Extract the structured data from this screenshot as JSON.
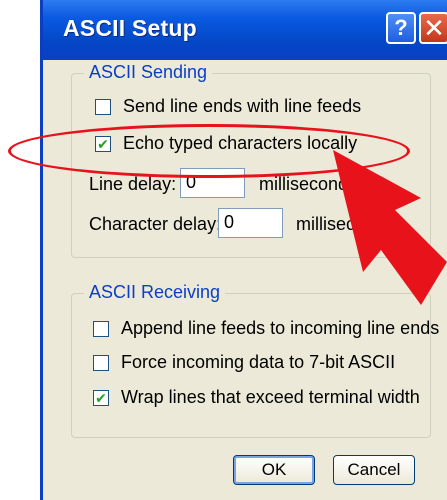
{
  "window": {
    "title": "ASCII Setup",
    "help_glyph": "?",
    "close_glyph": "✕"
  },
  "ascii_sending": {
    "legend": "ASCII Sending",
    "send_line_ends_label": "Send line ends with line feeds",
    "send_line_ends_checked": false,
    "echo_typed_label": "Echo typed characters locally",
    "echo_typed_checked": true,
    "line_delay_label": "Line delay:",
    "line_delay_value": "0",
    "line_delay_unit": "milliseconds.",
    "char_delay_label": "Character delay:",
    "char_delay_value": "0",
    "char_delay_unit": "milliseconds."
  },
  "ascii_receiving": {
    "legend": "ASCII Receiving",
    "append_lf_label": "Append line feeds to incoming line ends",
    "append_lf_checked": false,
    "force_7bit_label": "Force incoming data to 7-bit ASCII",
    "force_7bit_checked": false,
    "wrap_lines_label": "Wrap lines that exceed terminal width",
    "wrap_lines_checked": true
  },
  "buttons": {
    "ok": "OK",
    "cancel": "Cancel"
  },
  "check_glyph": "✔",
  "colors": {
    "title_bar": "#0a3fc4",
    "dialog_bg": "#ece9d8",
    "legend_text": "#0a3fc4",
    "annotation_red": "#e8121b"
  }
}
